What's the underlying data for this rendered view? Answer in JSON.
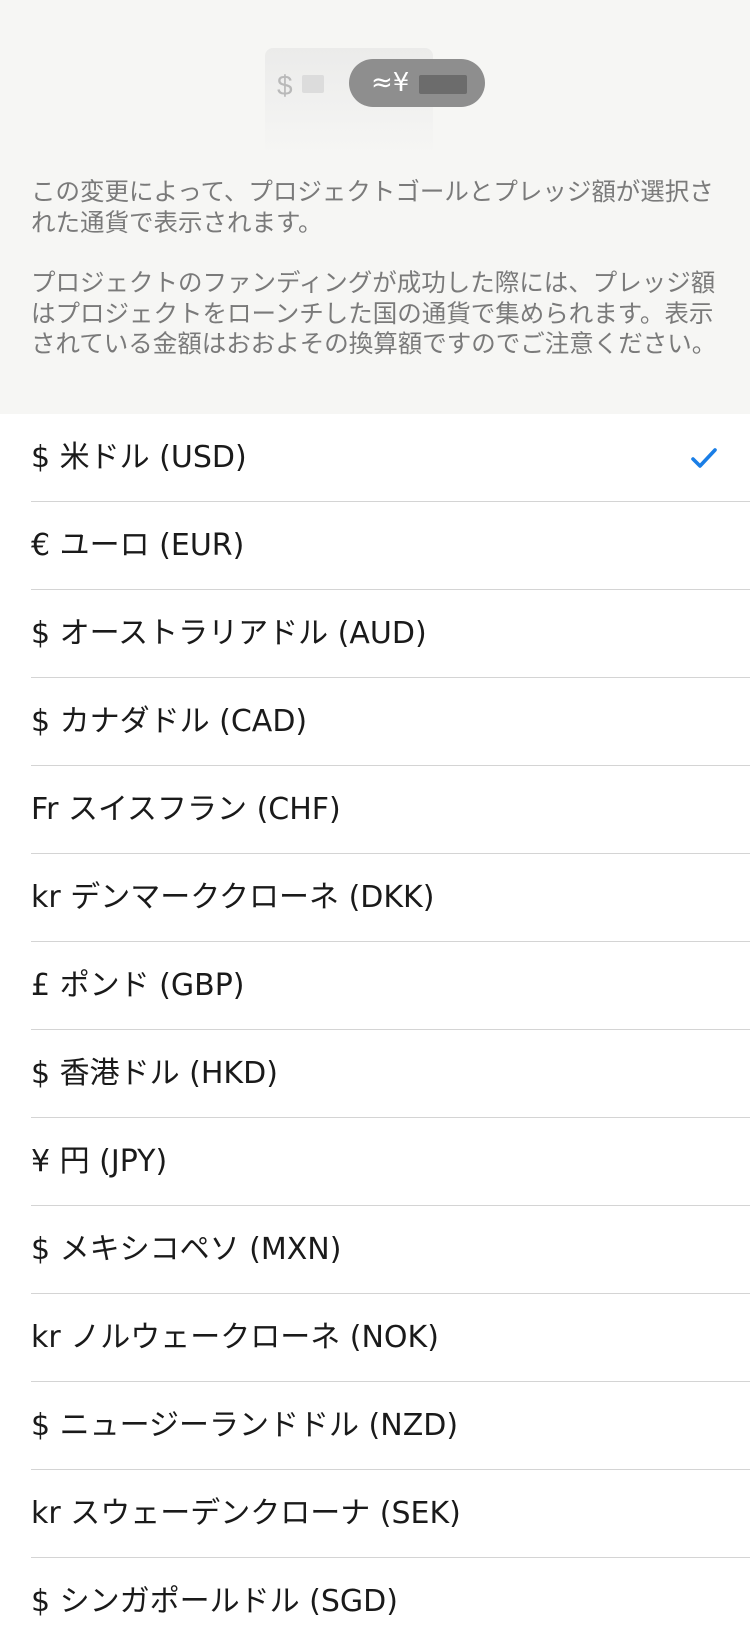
{
  "header": {
    "illustration": {
      "from_symbol": "$",
      "to_symbol": "≈¥"
    },
    "paragraph_1": "この変更によって、プロジェクトゴールとプレッジ額が選択された通貨で表示されます。",
    "paragraph_2": "プロジェクトのファンディングが成功した際には、プレッジ額はプロジェクトをローンチした国の通貨で集められます。表示されている金額はおおよその換算額ですのでご注意ください。"
  },
  "currencies": [
    {
      "label": "$ 米ドル (USD)",
      "selected": true
    },
    {
      "label": "€ ユーロ (EUR)",
      "selected": false
    },
    {
      "label": "$ オーストラリアドル (AUD)",
      "selected": false
    },
    {
      "label": "$ カナダドル (CAD)",
      "selected": false
    },
    {
      "label": "Fr スイスフラン (CHF)",
      "selected": false
    },
    {
      "label": "kr デンマーククローネ (DKK)",
      "selected": false
    },
    {
      "label": "£ ポンド (GBP)",
      "selected": false
    },
    {
      "label": "$ 香港ドル (HKD)",
      "selected": false
    },
    {
      "label": "¥ 円 (JPY)",
      "selected": false
    },
    {
      "label": "$ メキシコペソ (MXN)",
      "selected": false
    },
    {
      "label": "kr ノルウェークローネ (NOK)",
      "selected": false
    },
    {
      "label": "$ ニュージーランドドル (NZD)",
      "selected": false
    },
    {
      "label": "kr スウェーデンクローナ (SEK)",
      "selected": false
    },
    {
      "label": "$ シンガポールドル (SGD)",
      "selected": false
    }
  ],
  "selected_check_icon": "checkmark-icon",
  "colors": {
    "accent": "#1a7ee6",
    "header_bg": "#f6f6f4",
    "text_primary": "#1a1a1a",
    "text_secondary": "#7a7a7a",
    "separator": "#d4d4d4"
  }
}
